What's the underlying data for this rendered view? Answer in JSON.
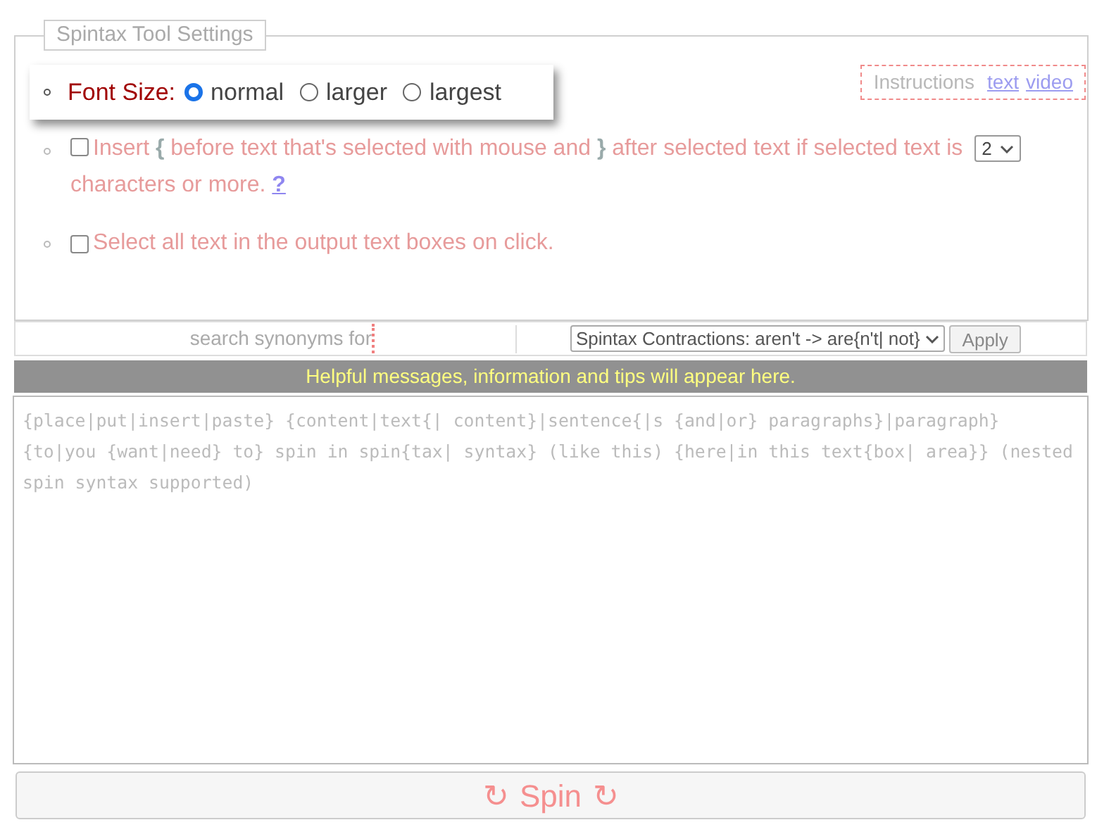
{
  "settings": {
    "legend": "Spintax Tool Settings",
    "font_size": {
      "label": "Font Size:",
      "options": [
        {
          "label": "normal",
          "selected": true
        },
        {
          "label": "larger",
          "selected": false
        },
        {
          "label": "largest",
          "selected": false
        }
      ]
    },
    "instructions": {
      "label": "Instructions",
      "links": [
        "text",
        "video"
      ]
    },
    "insert_option": {
      "checked": false,
      "segments": [
        {
          "kind": "text",
          "text": "Insert "
        },
        {
          "kind": "brace",
          "text": "{"
        },
        {
          "kind": "text",
          "text": " before text that's selected with mouse and "
        },
        {
          "kind": "brace",
          "text": "}"
        },
        {
          "kind": "text",
          "text": " after selected text if selected text is"
        }
      ],
      "select_value": "2",
      "suffix": "characters or more.",
      "help": "?"
    },
    "select_all_option": {
      "checked": false,
      "label": "Select all text in the output text boxes on click."
    }
  },
  "search": {
    "placeholder": "search synonyms for"
  },
  "contractions": {
    "select_value": "Spintax Contractions: aren't -> are{n't| not}",
    "apply": "Apply"
  },
  "message": "Helpful messages, information and tips will appear here.",
  "editor": {
    "placeholder": "{place|put|insert|paste} {content|text{| content}|sentence{|s {and|or} paragraphs}|paragraph} {to|you {want|need} to} spin in spin{tax| syntax} (like this) {here|in this text{box| area}} (nested spin syntax supported)"
  },
  "spin_button": {
    "icon": "↻",
    "label": "Spin"
  }
}
